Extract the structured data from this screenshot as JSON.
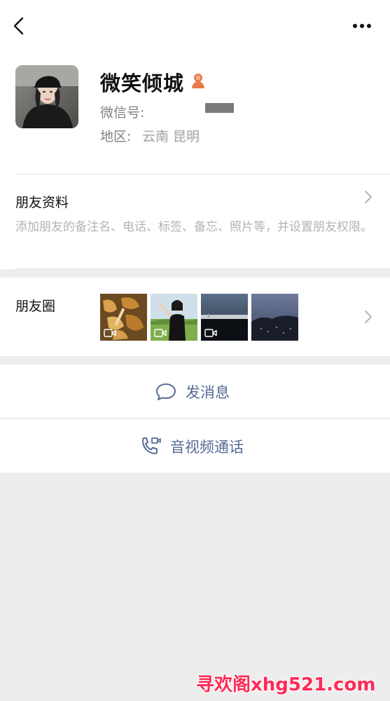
{
  "profile": {
    "name": "微笑倾城",
    "wxid_label": "微信号:",
    "region_label": "地区:",
    "region_value": "云南  昆明"
  },
  "friend_info": {
    "title": "朋友资料",
    "description": "添加朋友的备注名、电话、标签、备忘、照片等，并设置朋友权限。"
  },
  "moments": {
    "title": "朋友圈",
    "thumbnails": [
      "mushrooms-video",
      "woman-field-video",
      "night-sky-video",
      "city-dusk-photo"
    ]
  },
  "actions": {
    "message_label": "发消息",
    "call_label": "音视频通话"
  },
  "watermark": "寻欢阁xhg521.com",
  "colors": {
    "link_blue": "#576b95",
    "background": "#ededed",
    "gender_badge": "#e8794a"
  },
  "icons": [
    "back-icon",
    "more-icon",
    "gender-icon",
    "chevron-right-icon",
    "chat-bubble-icon",
    "video-call-icon",
    "video-camera-icon"
  ]
}
